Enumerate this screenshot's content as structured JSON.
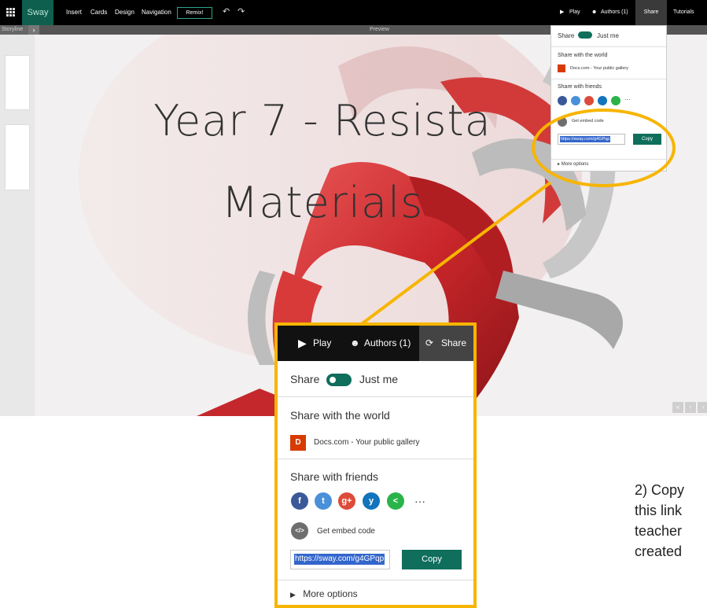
{
  "topbar": {
    "brand": "Sway",
    "menu": [
      "Insert",
      "Cards",
      "Design",
      "Navigation"
    ],
    "remix": "Remix!",
    "play": "Play",
    "authors": "Authors (1)",
    "share": "Share",
    "tutorials": "Tutorials"
  },
  "subbar": {
    "storyline": "Storyline",
    "preview": "Preview"
  },
  "hero": {
    "line1": "Year 7 - Resista",
    "line2": "Materials"
  },
  "share_panel": {
    "share_label": "Share",
    "scope": "Just me",
    "world_heading": "Share with the world",
    "docs_label": "Docs.com - Your public gallery",
    "friends_heading": "Share with friends",
    "social": [
      "Facebook",
      "Twitter",
      "Google+",
      "Yammer",
      "Share"
    ],
    "more_dots": "···",
    "embed_label": "Get embed code",
    "small_url": "https://sway.com/g4GPqp",
    "url": "https://sway.com/g4GPqp",
    "copy": "Copy",
    "more_options": "More options"
  },
  "zoom_bar": {
    "play": "Play",
    "authors": "Authors (1)",
    "share": "Share"
  },
  "instruction": {
    "lines": [
      "2) Copy",
      "this link",
      "teacher",
      "created"
    ]
  },
  "colors": {
    "accent": "#0f6e5c",
    "callout": "#f7b500",
    "facebook": "#3b5998",
    "twitter": "#4a90d9",
    "google": "#dd4b39",
    "yammer": "#1174bc",
    "share_green": "#2bb34a"
  }
}
